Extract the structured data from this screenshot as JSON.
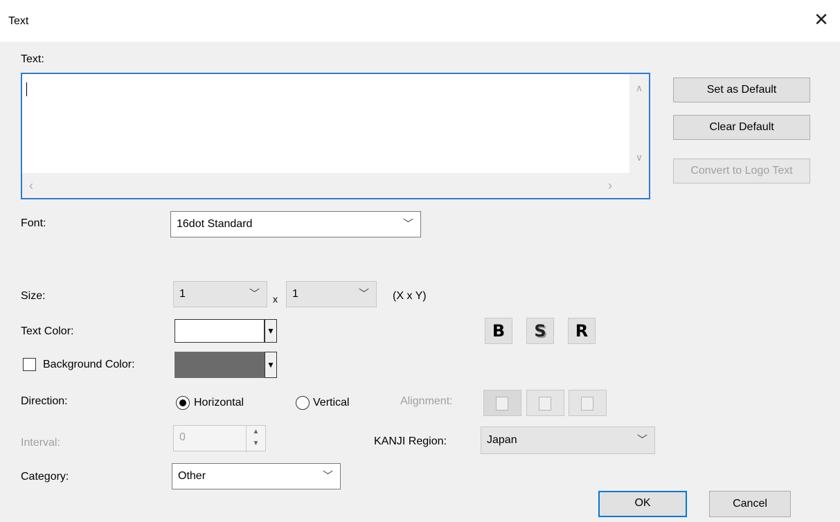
{
  "window": {
    "title": "Text",
    "close_glyph": "✕"
  },
  "text_section": {
    "label": "Text:",
    "value": ""
  },
  "side_buttons": {
    "set_default": "Set as Default",
    "clear_default": "Clear Default",
    "convert_logo": "Convert to Logo Text"
  },
  "font": {
    "label": "Font:",
    "value": "16dot Standard"
  },
  "size": {
    "label": "Size:",
    "x_value": "1",
    "y_value": "1",
    "separator": "x",
    "hint": "(X x Y)"
  },
  "text_color": {
    "label": "Text Color:",
    "swatch": "#ffffff"
  },
  "background_color": {
    "label": "Background Color:",
    "checked": false,
    "swatch": "#6b6b6b"
  },
  "style_buttons": {
    "bold": "B",
    "shadow": "S",
    "reverse": "R"
  },
  "direction": {
    "label": "Direction:",
    "horizontal": "Horizontal",
    "vertical": "Vertical",
    "selected": "horizontal"
  },
  "alignment": {
    "label": "Alignment:"
  },
  "interval": {
    "label": "Interval:",
    "value": "0"
  },
  "kanji_region": {
    "label": "KANJI Region:",
    "value": "Japan"
  },
  "category": {
    "label": "Category:",
    "value": "Other"
  },
  "footer": {
    "ok": "OK",
    "cancel": "Cancel"
  },
  "colors": {
    "accent": "#0078d7",
    "focus_border": "#2b7bd5"
  }
}
